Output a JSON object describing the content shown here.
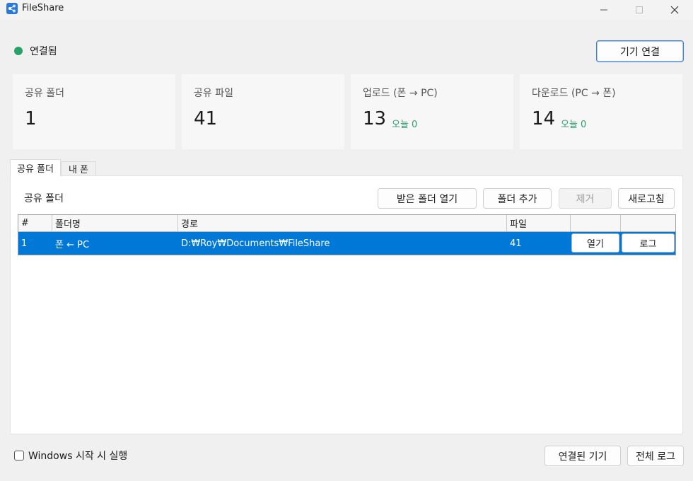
{
  "window": {
    "title": "FileShare",
    "minimize_icon": "minimize-icon",
    "maximize_icon": "maximize-icon",
    "close_icon": "close-icon"
  },
  "status": {
    "label": "연결됨",
    "color": "#2aa06a"
  },
  "connect_button": "기기 연결",
  "cards": [
    {
      "title": "공유 폴더",
      "value": "1",
      "sub": ""
    },
    {
      "title": "공유 파일",
      "value": "41",
      "sub": ""
    },
    {
      "title": "업로드 (폰 → PC)",
      "value": "13",
      "sub": "오늘 0"
    },
    {
      "title": "다운로드 (PC → 폰)",
      "value": "14",
      "sub": "오늘 0"
    }
  ],
  "tabs": [
    {
      "label": "공유 폴더",
      "active": true
    },
    {
      "label": "내 폰",
      "active": false
    }
  ],
  "panel": {
    "title": "공유 폴더",
    "buttons": {
      "open_received": "받은 폴더 열기",
      "add_folder": "폴더 추가",
      "remove": "제거",
      "refresh": "새로고침"
    }
  },
  "table": {
    "columns": [
      "#",
      "폴더명",
      "경로",
      "파일",
      "",
      ""
    ],
    "rows": [
      {
        "num": "1",
        "name": "폰 ← PC",
        "path": "D:₩Roy₩Documents₩FileShare",
        "files": "41",
        "open": "열기",
        "log": "로그"
      }
    ],
    "selected_color": "#0078d7"
  },
  "footer": {
    "startup_label": "Windows 시작 시 실행",
    "startup_checked": false,
    "connected_devices": "연결된 기기",
    "all_logs": "전체 로그"
  }
}
